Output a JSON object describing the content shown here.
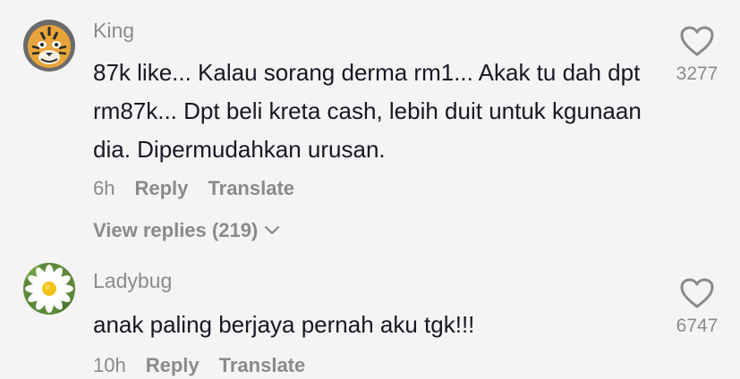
{
  "comments": [
    {
      "username": "King",
      "text": "87k like... Kalau sorang derma rm1... Akak tu dah dpt rm87k... Dpt beli kreta cash, lebih duit untuk kgunaan dia. Dipermudahkan urusan.",
      "time": "6h",
      "reply_label": "Reply",
      "translate_label": "Translate",
      "view_replies_label": "View replies (219)",
      "likes": "3277",
      "avatar_icon": "tiger-avatar-icon"
    },
    {
      "username": "Ladybug",
      "text": "anak paling berjaya pernah aku tgk!!!",
      "time": "10h",
      "reply_label": "Reply",
      "translate_label": "Translate",
      "likes": "6747",
      "avatar_icon": "daisy-avatar-icon"
    }
  ]
}
